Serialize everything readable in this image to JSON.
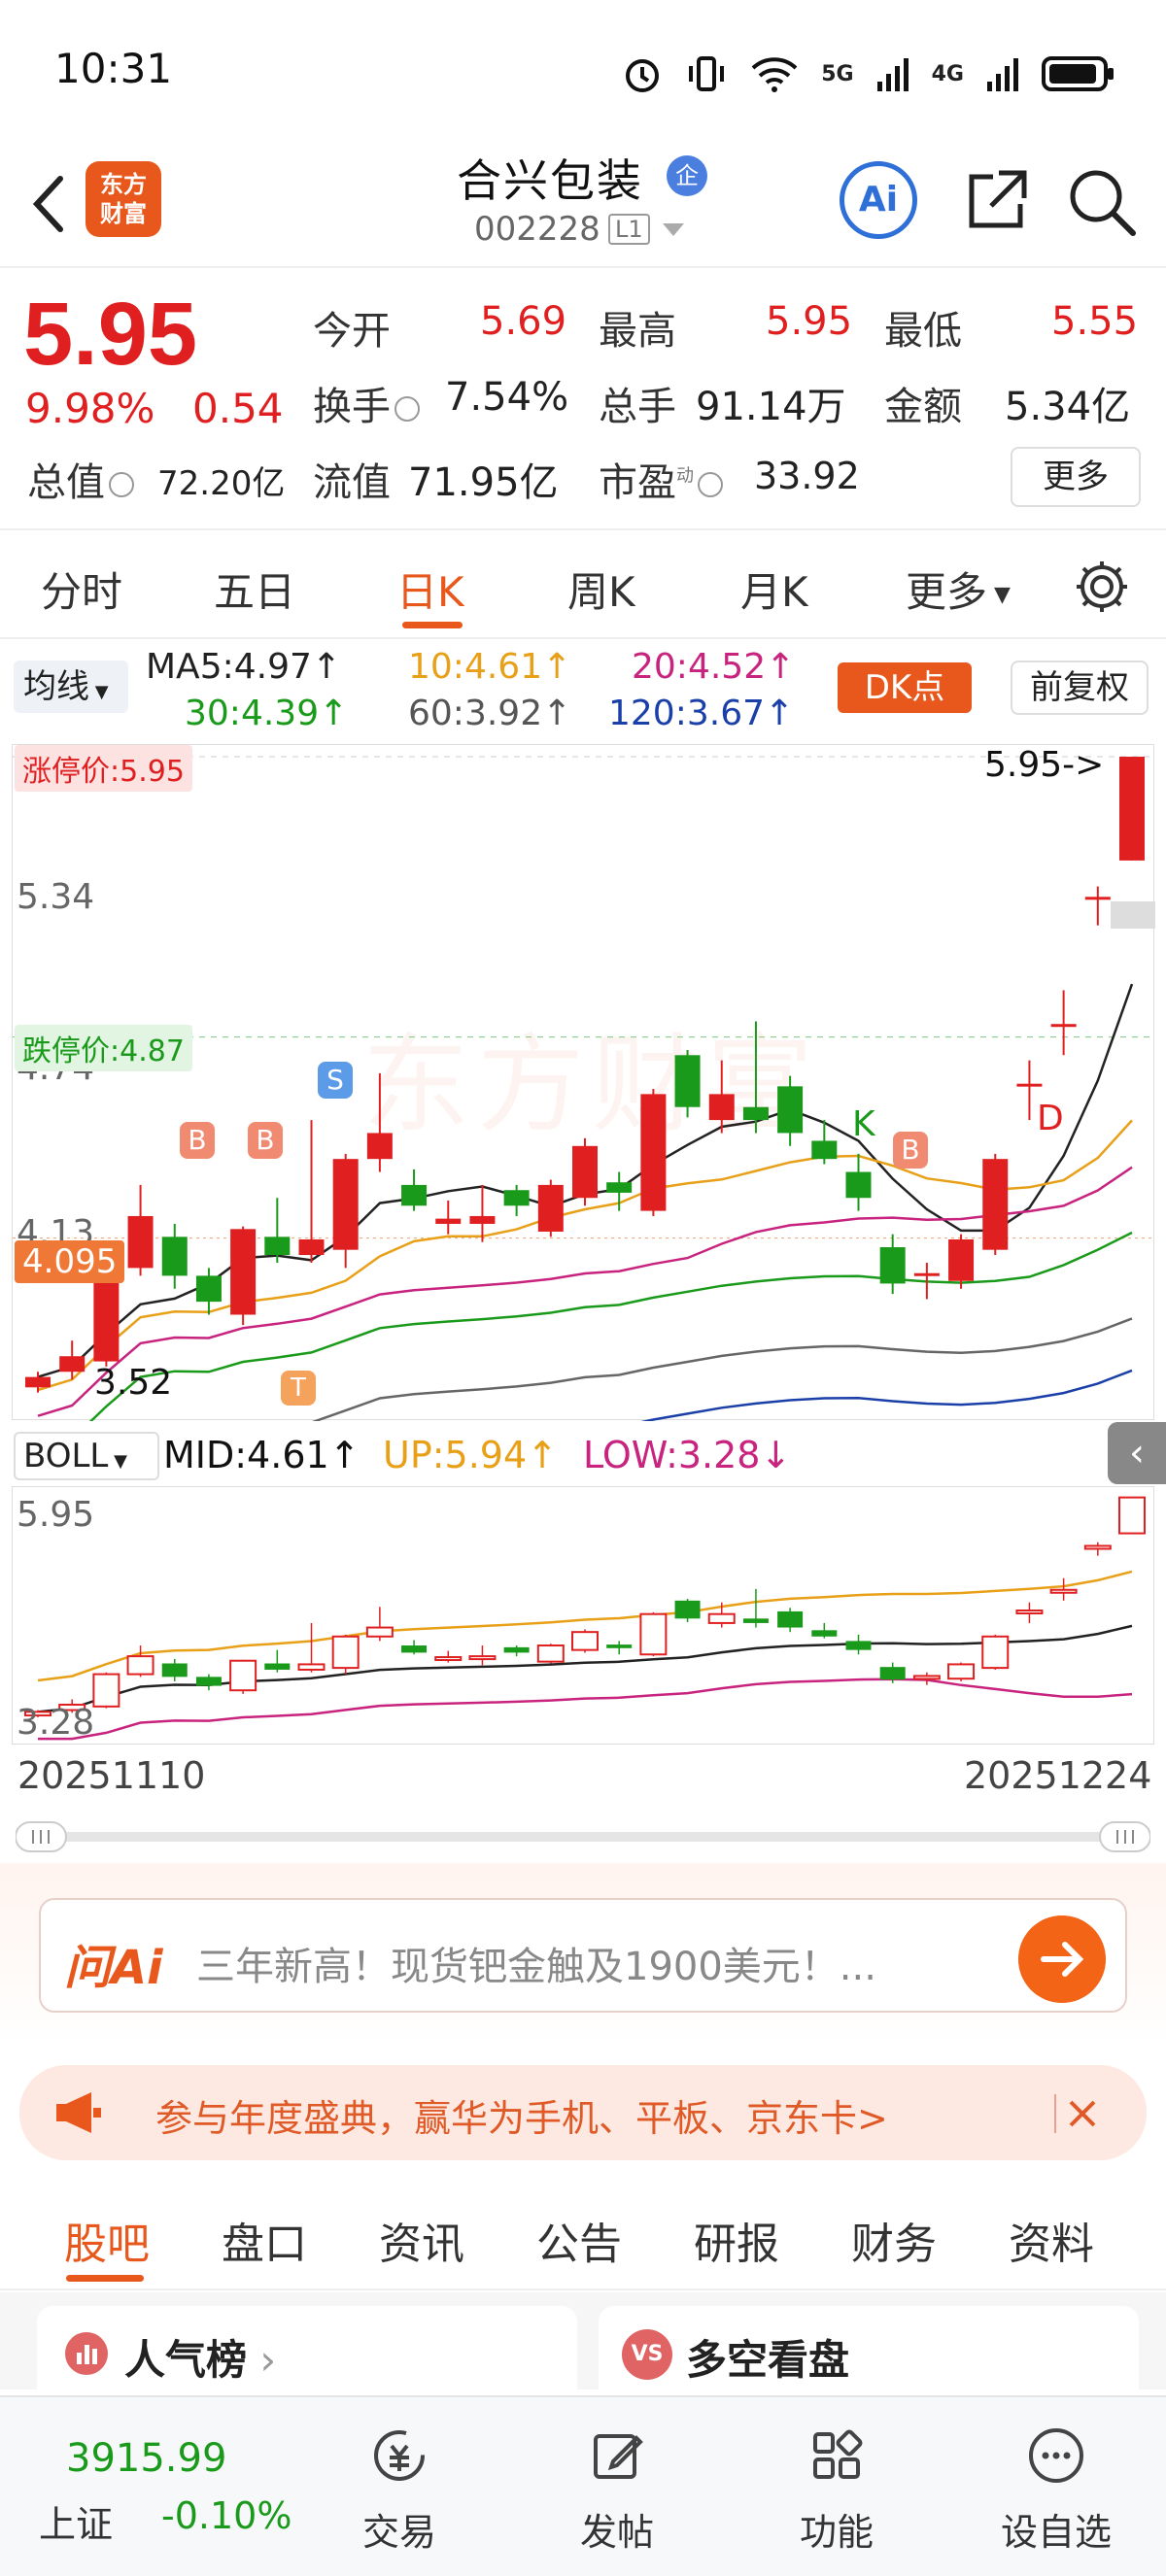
{
  "status_bar": {
    "time": "10:31",
    "net1": "5G",
    "net2": "4G"
  },
  "header": {
    "app_logo": "东方\n财富",
    "stock_name": "合兴包装",
    "enterprise_badge": "企",
    "stock_code": "002228",
    "level_tag": "L1",
    "ai_label": "Ai"
  },
  "quote": {
    "price": "5.95",
    "change_pct": "9.98%",
    "change": "0.54",
    "open_label": "今开",
    "open": "5.69",
    "high_label": "最高",
    "high": "5.95",
    "low_label": "最低",
    "low": "5.55",
    "turnover_label": "换手",
    "turnover": "7.54%",
    "volume_label": "总手",
    "volume": "91.14万",
    "amount_label": "金额",
    "amount": "5.34亿",
    "mcap_label": "总值",
    "mcap": "72.20亿",
    "float_label": "流值",
    "float": "71.95亿",
    "pe_label": "市盈",
    "pe_sup": "动",
    "pe": "33.92",
    "more": "更多"
  },
  "period_tabs": [
    "分时",
    "五日",
    "日K",
    "周K",
    "月K",
    "更多"
  ],
  "ma_legend": {
    "selector": "均线",
    "ma5": "MA5:4.97↑",
    "ma10": "10:4.61↑",
    "ma20": "20:4.52↑",
    "ma30": "30:4.39↑",
    "ma60": "60:3.92↑",
    "ma120": "120:3.67↑",
    "dk_button": "DK点",
    "fq_button": "前复权"
  },
  "chart": {
    "limit_up_tag": "涨停价:5.95",
    "limit_down_tag": "跌停价:4.87",
    "current_tag": "4.095",
    "price_label_top": "5.95->",
    "low_label": "3.52",
    "axis": [
      "5.34",
      "4.74",
      "4.13"
    ],
    "watermark": "东方财富",
    "marks": {
      "b": "B",
      "s": "S",
      "t": "T",
      "k": "K",
      "d": "D"
    }
  },
  "chart_data": {
    "type": "candlestick",
    "date_range": [
      "20251110",
      "20251224"
    ],
    "y_ticks": [
      5.95,
      5.34,
      4.74,
      4.13,
      3.52
    ],
    "candles": [
      {
        "o": 3.52,
        "c": 3.56,
        "h": 3.58,
        "l": 3.5
      },
      {
        "o": 3.58,
        "c": 3.64,
        "h": 3.7,
        "l": 3.55
      },
      {
        "o": 3.62,
        "c": 3.98,
        "h": 4.0,
        "l": 3.6
      },
      {
        "o": 3.98,
        "c": 4.18,
        "h": 4.3,
        "l": 3.95
      },
      {
        "o": 4.1,
        "c": 3.95,
        "h": 4.15,
        "l": 3.9
      },
      {
        "o": 3.95,
        "c": 3.85,
        "h": 3.98,
        "l": 3.8
      },
      {
        "o": 3.8,
        "c": 4.13,
        "h": 4.14,
        "l": 3.76
      },
      {
        "o": 4.1,
        "c": 4.03,
        "h": 4.25,
        "l": 4.0
      },
      {
        "o": 4.03,
        "c": 4.09,
        "h": 4.55,
        "l": 4.0
      },
      {
        "o": 4.05,
        "c": 4.4,
        "h": 4.42,
        "l": 3.98
      },
      {
        "o": 4.4,
        "c": 4.5,
        "h": 4.73,
        "l": 4.35
      },
      {
        "o": 4.3,
        "c": 4.22,
        "h": 4.36,
        "l": 4.2
      },
      {
        "o": 4.15,
        "c": 4.17,
        "h": 4.24,
        "l": 4.11
      },
      {
        "o": 4.15,
        "c": 4.18,
        "h": 4.3,
        "l": 4.08
      },
      {
        "o": 4.28,
        "c": 4.22,
        "h": 4.3,
        "l": 4.18
      },
      {
        "o": 4.12,
        "c": 4.3,
        "h": 4.32,
        "l": 4.1
      },
      {
        "o": 4.25,
        "c": 4.45,
        "h": 4.48,
        "l": 4.22
      },
      {
        "o": 4.31,
        "c": 4.27,
        "h": 4.35,
        "l": 4.2
      },
      {
        "o": 4.2,
        "c": 4.65,
        "h": 4.67,
        "l": 4.18
      },
      {
        "o": 4.8,
        "c": 4.6,
        "h": 4.82,
        "l": 4.56
      },
      {
        "o": 4.55,
        "c": 4.65,
        "h": 4.78,
        "l": 4.5
      },
      {
        "o": 4.6,
        "c": 4.55,
        "h": 4.93,
        "l": 4.5
      },
      {
        "o": 4.68,
        "c": 4.5,
        "h": 4.72,
        "l": 4.45
      },
      {
        "o": 4.47,
        "c": 4.4,
        "h": 4.55,
        "l": 4.38
      },
      {
        "o": 4.35,
        "c": 4.25,
        "h": 4.42,
        "l": 4.2
      },
      {
        "o": 4.06,
        "c": 3.92,
        "h": 4.11,
        "l": 3.88
      },
      {
        "o": 3.95,
        "c": 3.96,
        "h": 4.0,
        "l": 3.86
      },
      {
        "o": 3.93,
        "c": 4.09,
        "h": 4.11,
        "l": 3.9
      },
      {
        "o": 4.05,
        "c": 4.4,
        "h": 4.42,
        "l": 4.03
      },
      {
        "o": 4.69,
        "c": 4.69,
        "h": 4.78,
        "l": 4.55
      },
      {
        "o": 4.92,
        "c": 4.92,
        "h": 5.05,
        "l": 4.8
      },
      {
        "o": 5.41,
        "c": 5.41,
        "h": 5.45,
        "l": 5.3
      },
      {
        "o": 5.55,
        "c": 5.95,
        "h": 5.95,
        "l": 5.55
      }
    ],
    "boll": {
      "mid": "MID:4.61↑",
      "up": "UP:5.94↑",
      "low": "LOW:3.28↓",
      "y_ticks": [
        "5.95",
        "3.28"
      ]
    }
  },
  "boll_bar": {
    "selector": "BOLL"
  },
  "date_start": "20251110",
  "date_end": "20251224",
  "ai_bar": {
    "logo": "问Ai",
    "text": "三年新高！现货钯金触及1900美元！..."
  },
  "promo": {
    "text": "参与年度盛典，赢华为手机、平板、京东卡>"
  },
  "bottom_tabs": [
    "股吧",
    "盘口",
    "资讯",
    "公告",
    "研报",
    "财务",
    "资料"
  ],
  "cards": {
    "popularity": "人气榜",
    "long_short": "多空看盘",
    "vs_badge": "VS"
  },
  "bottom_nav": {
    "index_value": "3915.99",
    "index_name": "上证",
    "index_change": "-0.10%",
    "trade": "交易",
    "post": "发帖",
    "functions": "功能",
    "watchlist": "设自选"
  },
  "colors": {
    "up": "#e02020",
    "down": "#1a9a1a",
    "accent": "#e8581c"
  }
}
